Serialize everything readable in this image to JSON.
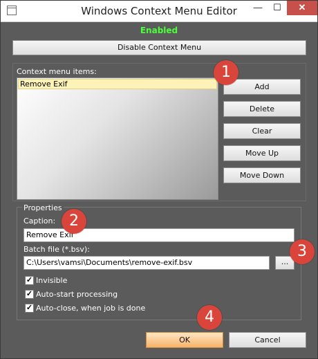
{
  "window": {
    "title": "Windows Context Menu Editor",
    "minimize_glyph": "—",
    "maximize_glyph": "☐",
    "close_glyph": "✕"
  },
  "status": {
    "text": "Enabled",
    "color": "#4cff3c"
  },
  "disable_button": "Disable Context Menu",
  "items": {
    "label": "Context menu items:",
    "list": [
      "Remove Exif"
    ],
    "buttons": [
      "Add",
      "Delete",
      "Clear",
      "Move Up",
      "Move Down"
    ]
  },
  "properties": {
    "group_label": "Properties",
    "caption_label": "Caption:",
    "caption_value": "Remove Exif",
    "batch_label": "Batch file (*.bsv):",
    "batch_value": "C:\\Users\\vamsi\\Documents\\remove-exif.bsv",
    "browse_label": "...",
    "checkboxes": [
      {
        "label": "Invisible",
        "checked": true
      },
      {
        "label": "Auto-start processing",
        "checked": true
      },
      {
        "label": "Auto-close, when job is done",
        "checked": true
      }
    ]
  },
  "footer": {
    "ok": "OK",
    "cancel": "Cancel"
  },
  "badges": [
    "1",
    "2",
    "3",
    "4"
  ],
  "colors": {
    "badge": "#d9453b",
    "ok_button": "#f7b36a"
  }
}
